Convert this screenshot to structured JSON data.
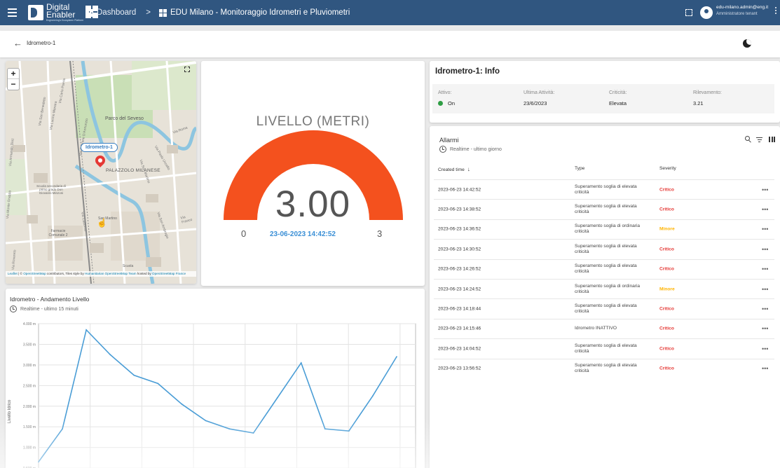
{
  "topbar": {
    "logo_line1": "Digital",
    "logo_line2": "Enabler",
    "logo_tagline": "Engineering's Ecosystem Platform",
    "crumb_dashboard": "Dashboard",
    "crumb_separator": ">",
    "crumb_current": "EDU Milano - Monitoraggio Idrometri e Pluviometri",
    "user_email": "edu-milano.admin@eng.it",
    "user_role": "Amministratore tenant",
    "color": "#305680"
  },
  "subbar": {
    "title": "Idrometro-1"
  },
  "map": {
    "zoom_in": "+",
    "zoom_out": "−",
    "marker_label": "Idrometro-1",
    "places": [
      "Parco del Seveso",
      "PALAZZOLO MILANESE",
      "Scuola secondaria di primo grado Don Giovanni Minzoni",
      "San Martino",
      "Farmacie Comunale 2",
      "Scuola",
      "Via Carlo Poerio",
      "Via Lucino Manara",
      "Via San Benedetto",
      "Via Armando Diaz",
      "Via Gabriele D'Annunzio",
      "Via Monte Grappa",
      "Via San Martino",
      "Via Paolo Uccello",
      "Via Cadorna",
      "Via Roma",
      "Via Rovereto",
      "Via Franco",
      "Via San Ambrogio"
    ],
    "attribution_leaflet": "Leaflet",
    "attribution_text1": " | © ",
    "attribution_osm": "OpenStreetMap",
    "attribution_text2": " contributors, Tiles style by ",
    "attribution_hot": "Humanitarian OpenStreetMap Team",
    "attribution_text3": " hosted by ",
    "attribution_osmfr": "OpenStreetMap France"
  },
  "gauge": {
    "title": "LIVELLO (METRI)",
    "value": "3.00",
    "value_number": 3.0,
    "min": "0",
    "max": "3",
    "min_number": 0,
    "max_number": 3,
    "timestamp": "23-06-2023 14:42:52",
    "bar_color": "#f4511e",
    "timestamp_color": "#3a8fd6"
  },
  "chart": {
    "title": "Idrometro - Andamento Livello",
    "subtitle": "Realtime - ultimo 15 minuti",
    "ylabel": "Livello Idrico",
    "yticks": [
      "4.000 m",
      "3.500 m",
      "3.000 m",
      "2.500 m",
      "2.000 m",
      "1.500 m",
      "1.000 m",
      "0.500 m"
    ]
  },
  "chart_data": {
    "type": "line",
    "title": "Idrometro - Andamento Livello",
    "ylabel": "Livello Idrico",
    "ylim": [
      0.4,
      4.0
    ],
    "grid": true,
    "color": "#4a9dd6",
    "x": [
      0,
      1,
      2,
      3,
      4,
      5,
      6,
      7,
      8,
      9,
      10,
      11,
      12,
      13,
      14,
      15
    ],
    "values": [
      0.65,
      1.45,
      3.85,
      3.25,
      2.75,
      2.55,
      2.05,
      1.65,
      1.45,
      1.35,
      2.2,
      3.05,
      1.45,
      1.4,
      2.25,
      3.2
    ]
  },
  "info": {
    "title": "Idrometro-1: Info",
    "fields": [
      {
        "label": "Attivo:",
        "value": "On",
        "dot": "#2e9d43"
      },
      {
        "label": "Ultima Attività:",
        "value": "23/6/2023"
      },
      {
        "label": "Criticità:",
        "value": "Elevata"
      },
      {
        "label": "Rilevamento:",
        "value": "3.21"
      }
    ]
  },
  "alarms": {
    "title": "Allarmi",
    "subtitle": "Realtime - ultimo giorno",
    "columns": [
      "Created time",
      "Type",
      "Severity"
    ],
    "rows": [
      {
        "time": "2023-06-23 14:42:52",
        "type": "Superamento soglia di elevata criticità",
        "severity": "Critico"
      },
      {
        "time": "2023-06-23 14:38:52",
        "type": "Superamento soglia di elevata criticità",
        "severity": "Critico"
      },
      {
        "time": "2023-06-23 14:36:52",
        "type": "Superamento soglia di ordinaria criticità",
        "severity": "Minore"
      },
      {
        "time": "2023-06-23 14:30:52",
        "type": "Superamento soglia di elevata criticità",
        "severity": "Critico"
      },
      {
        "time": "2023-06-23 14:26:52",
        "type": "Superamento soglia di elevata criticità",
        "severity": "Critico"
      },
      {
        "time": "2023-06-23 14:24:52",
        "type": "Superamento soglia di ordinaria criticità",
        "severity": "Minore"
      },
      {
        "time": "2023-06-23 14:18:44",
        "type": "Superamento soglia di elevata criticità",
        "severity": "Critico"
      },
      {
        "time": "2023-06-23 14:15:46",
        "type": "Idrometro INATTIVO",
        "severity": "Critico"
      },
      {
        "time": "2023-06-23 14:04:52",
        "type": "Superamento soglia di elevata criticità",
        "severity": "Critico"
      },
      {
        "time": "2023-06-23 13:56:52",
        "type": "Superamento soglia di elevata criticità",
        "severity": "Critico"
      }
    ],
    "more_label": "•••",
    "critical_color": "#e53935",
    "minor_color": "#ffb300"
  }
}
